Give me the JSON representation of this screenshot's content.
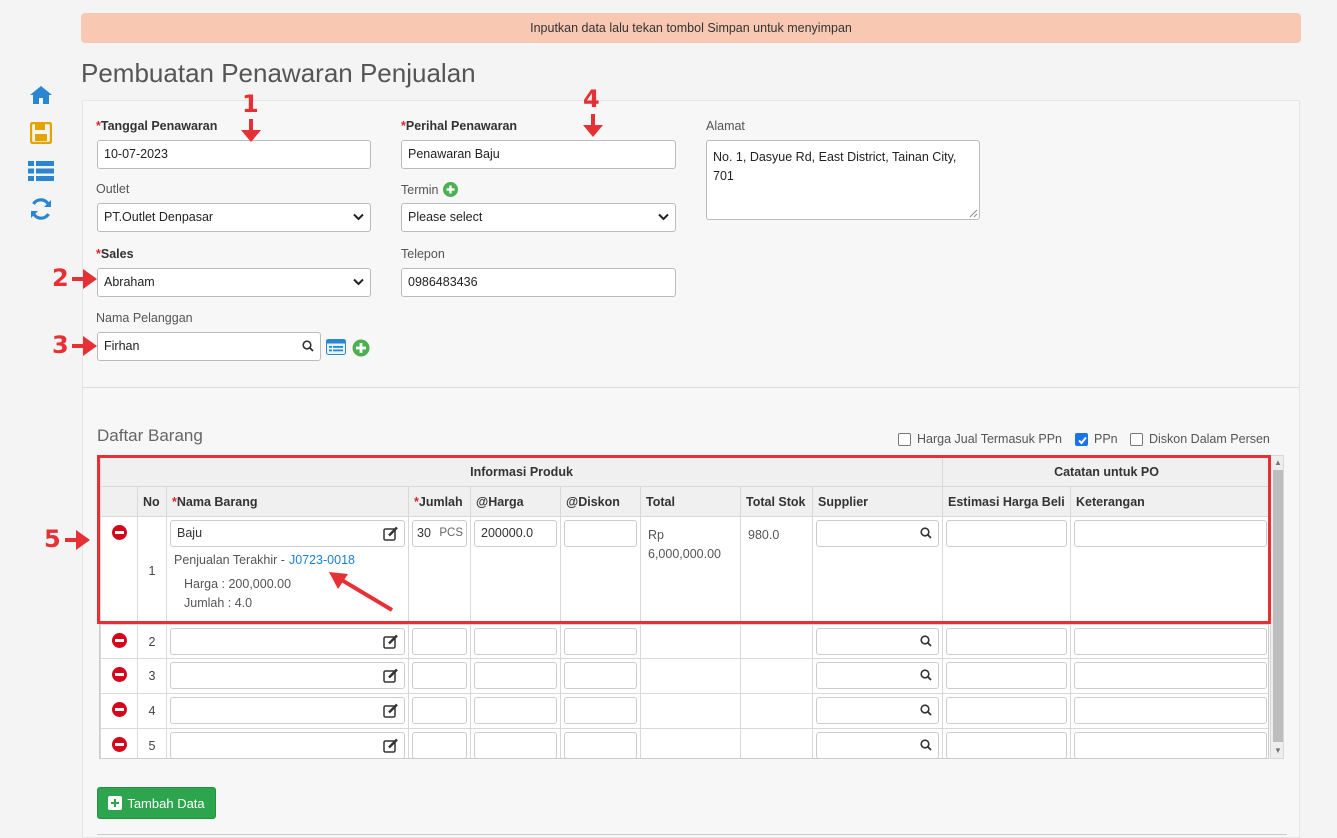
{
  "notice": "Inputkan data lalu tekan tombol Simpan untuk menyimpan",
  "page_title": "Pembuatan Penawaran Penjualan",
  "sidebar": {
    "icons": [
      "home-icon",
      "save-icon",
      "list-icon",
      "refresh-icon"
    ]
  },
  "form": {
    "tanggal": {
      "label": "Tanggal Penawaran",
      "value": "10-07-2023"
    },
    "perihal": {
      "label": "Perihal Penawaran",
      "value": "Penawaran Baju"
    },
    "alamat": {
      "label": "Alamat",
      "value": "No. 1, Dasyue Rd, East District, Tainan City, 701"
    },
    "outlet": {
      "label": "Outlet",
      "value": "PT.Outlet Denpasar"
    },
    "termin": {
      "label": "Termin",
      "value": "Please select"
    },
    "sales": {
      "label": "Sales",
      "value": "Abraham"
    },
    "telepon": {
      "label": "Telepon",
      "value": "0986483436"
    },
    "pelanggan": {
      "label": "Nama Pelanggan",
      "value": "Firhan"
    },
    "required_mark": "*"
  },
  "annotations": [
    "1",
    "2",
    "3",
    "4",
    "5"
  ],
  "daftar": {
    "title": "Daftar Barang",
    "options": [
      {
        "label": "Harga Jual Termasuk PPn",
        "checked": false
      },
      {
        "label": "PPn",
        "checked": true
      },
      {
        "label": "Diskon Dalam Persen",
        "checked": false
      }
    ],
    "group_headers": {
      "info": "Informasi Produk",
      "po": "Catatan untuk PO"
    },
    "columns": {
      "no": "No",
      "nama": "Nama Barang",
      "jumlah": "Jumlah",
      "harga": "@Harga",
      "diskon": "@Diskon",
      "total": "Total",
      "stok": "Total Stok",
      "supplier": "Supplier",
      "estimasi": "Estimasi Harga Beli",
      "keterangan": "Keterangan"
    },
    "row1": {
      "no": "1",
      "nama": "Baju",
      "jumlah": "30",
      "unit": "PCS",
      "harga": "200000.0",
      "total_prefix": "Rp",
      "total": "6,000,000.00",
      "stok": "980.0",
      "last_sale_label": "Penjualan Terakhir -",
      "last_sale_link": "J0723-0018",
      "last_price": "Harga : 200,000.00",
      "last_qty": "Jumlah : 4.0"
    },
    "empty_rows": [
      "2",
      "3",
      "4",
      "5"
    ]
  },
  "add_button": "Tambah Data"
}
